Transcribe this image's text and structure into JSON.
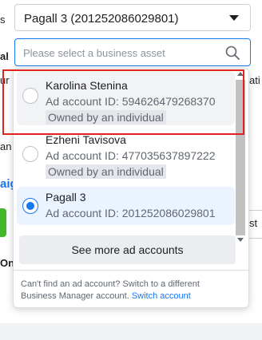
{
  "background": {
    "fragments": [
      "s",
      "al",
      "ur b",
      "ati",
      "an",
      "aig",
      "st",
      "On"
    ]
  },
  "account_select": {
    "value": "Pagall 3 (201252086029801)"
  },
  "search": {
    "placeholder": "Please select a business asset",
    "value": ""
  },
  "options": [
    {
      "name": "Karolina Stenina",
      "id_text": "Ad account ID: 594626479268370",
      "badge": "Owned by an individual",
      "selected": false
    },
    {
      "name": "Ezheni Tavisova",
      "id_text": "Ad account ID: 477035637897222",
      "badge": "Owned by an individual",
      "selected": false
    },
    {
      "name": "Pagall 3",
      "id_text": "Ad account ID: 201252086029801",
      "badge": "",
      "selected": true
    }
  ],
  "see_more_label": "See more ad accounts",
  "footer": {
    "text": "Can't find an ad account? Switch to a different Business Manager account.",
    "link": "Switch account"
  },
  "colors": {
    "accent": "#1877f2",
    "highlight": "#e0251b"
  },
  "icons": {
    "search": "search-icon",
    "caret": "caret-down-icon"
  }
}
